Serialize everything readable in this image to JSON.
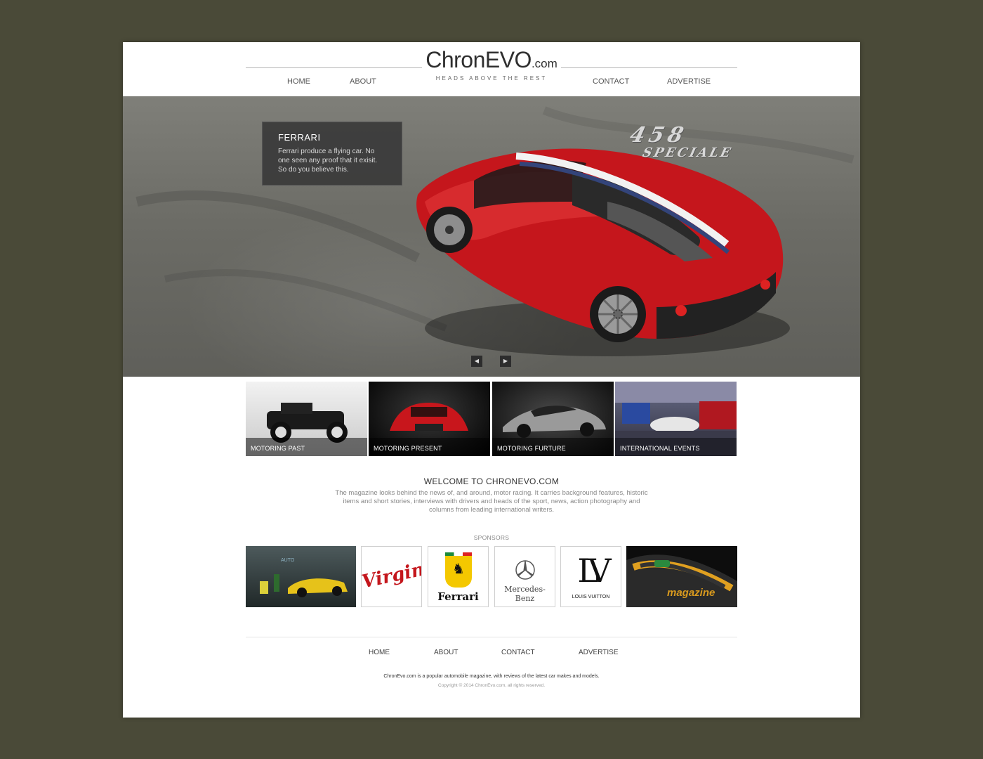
{
  "header": {
    "logo_main": "ChronEVO",
    "logo_suffix": ".com",
    "tagline": "HEADS ABOVE THE REST",
    "nav": [
      "HOME",
      "ABOUT",
      "CONTACT",
      "ADVERTISE"
    ]
  },
  "hero": {
    "caption_title": "FERRARI",
    "caption_text": "Ferrari produce a flying car. No one seen any proof that it exisit. So do you believe this.",
    "badge_line1": "458",
    "badge_line2": "SPECIALE",
    "prev_icon": "triangle-left",
    "next_icon": "triangle-right"
  },
  "categories": [
    {
      "label": "MOTORING PAST"
    },
    {
      "label": "MOTORING PRESENT"
    },
    {
      "label": "MOTORING FURTURE"
    },
    {
      "label": "INTERNATIONAL EVENTS"
    }
  ],
  "welcome": {
    "title": "WELCOME TO CHRONEVO.COM",
    "text": "The magazine looks behind the news of, and around, motor racing. It carries background features, historic items and short stories, interviews with drivers and heads of the sport, news, action photography and columns from leading international writers."
  },
  "sponsors": {
    "title": "SPONSORS",
    "virgin": "Virgin",
    "ferrari": "Ferrari",
    "mercedes": "Mercedes-Benz",
    "lv_mark": "LV",
    "lv_name": "LOUIS VUITTON",
    "magazine": "magazine"
  },
  "footer": {
    "nav": [
      "HOME",
      "ABOUT",
      "CONTACT",
      "ADVERTISE"
    ],
    "text": "ChronEvo.com is a popular automobile magazine, with reviews of the latest car makes and models.",
    "copyright": "Copyright © 2014 ChronEvo.com, all rights reserved."
  },
  "colors": {
    "background": "#4a4a38",
    "accent_red": "#c4161c",
    "caption_bg": "#3a3a3a"
  }
}
